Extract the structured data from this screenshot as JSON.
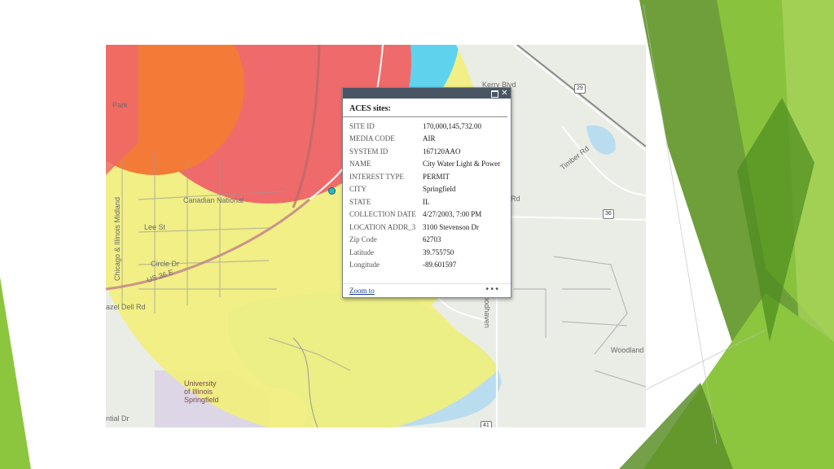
{
  "popup": {
    "title": "ACES sites:",
    "attributes": [
      {
        "key": "SITE ID",
        "value": "170,000,145,732.00"
      },
      {
        "key": "MEDIA CODE",
        "value": "AIR"
      },
      {
        "key": "SYSTEM ID",
        "value": "167120AAO"
      },
      {
        "key": "NAME",
        "value": "City Water Light & Power"
      },
      {
        "key": "INTEREST TYPE",
        "value": "PERMIT"
      },
      {
        "key": "CITY",
        "value": "Springfield"
      },
      {
        "key": "STATE",
        "value": "IL"
      },
      {
        "key": "COLLECTION DATE",
        "value": "4/27/2003, 7:00 PM"
      },
      {
        "key": "LOCATION ADDR_3",
        "value": "3100 Stevenson Dr"
      },
      {
        "key": "Zip Code",
        "value": "62703"
      },
      {
        "key": "Latitude",
        "value": "39.755750"
      },
      {
        "key": "Longitude",
        "value": "-89.601597"
      }
    ],
    "zoom_link": "Zoom to",
    "more_icon": "ellipsis-icon",
    "maximize_icon": "maximize-icon",
    "close_icon": "close-icon"
  },
  "map": {
    "labels": {
      "kerry_blvd": "Kerry Blvd",
      "canadian_national": "Canadian National",
      "lee_st": "Lee St",
      "circle_dr": "Circle Dr",
      "hazel_dell": "azel Dell Rd",
      "us36": "US 36 E",
      "university": "University",
      "of_illinois": "of Illinois",
      "springfield": "Springfield",
      "woodhaven": "Woodhaven",
      "woodland": "Woodland",
      "rd": "Rd",
      "mi_dr": "ntial Dr",
      "timber_rd": "Timber Rd",
      "park": "Park",
      "chicago": "Chicago & Illinois Midland"
    },
    "shields": {
      "s29": "29",
      "s36": "36",
      "s41": "41"
    }
  },
  "colors": {
    "zone_red": "#ef6a6a",
    "zone_orange": "#f47b37",
    "zone_yellow": "#f2f07a",
    "zone_cyan": "#5fd3ee",
    "lake": "#b9dcef",
    "green_accent": "#8cc63f"
  }
}
